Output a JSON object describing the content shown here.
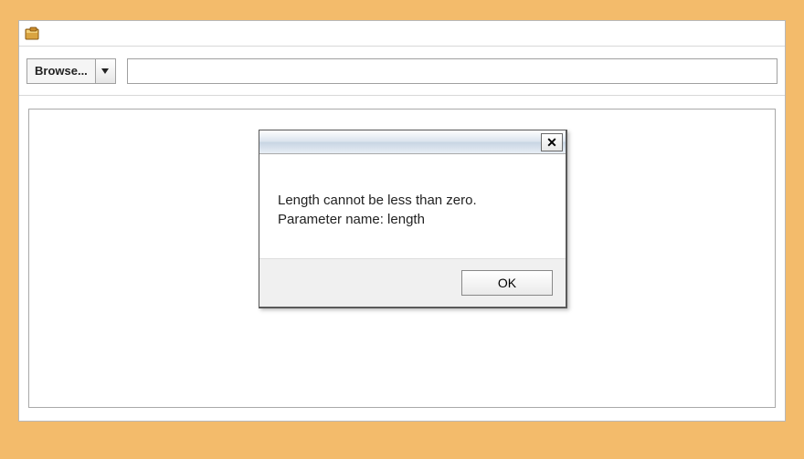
{
  "window": {
    "title": ""
  },
  "toolbar": {
    "browse_label": "Browse...",
    "address_value": ""
  },
  "dialog": {
    "close_glyph": "✕",
    "message_line1": "Length cannot be less than zero.",
    "message_line2": "Parameter name: length",
    "ok_label": "OK"
  }
}
